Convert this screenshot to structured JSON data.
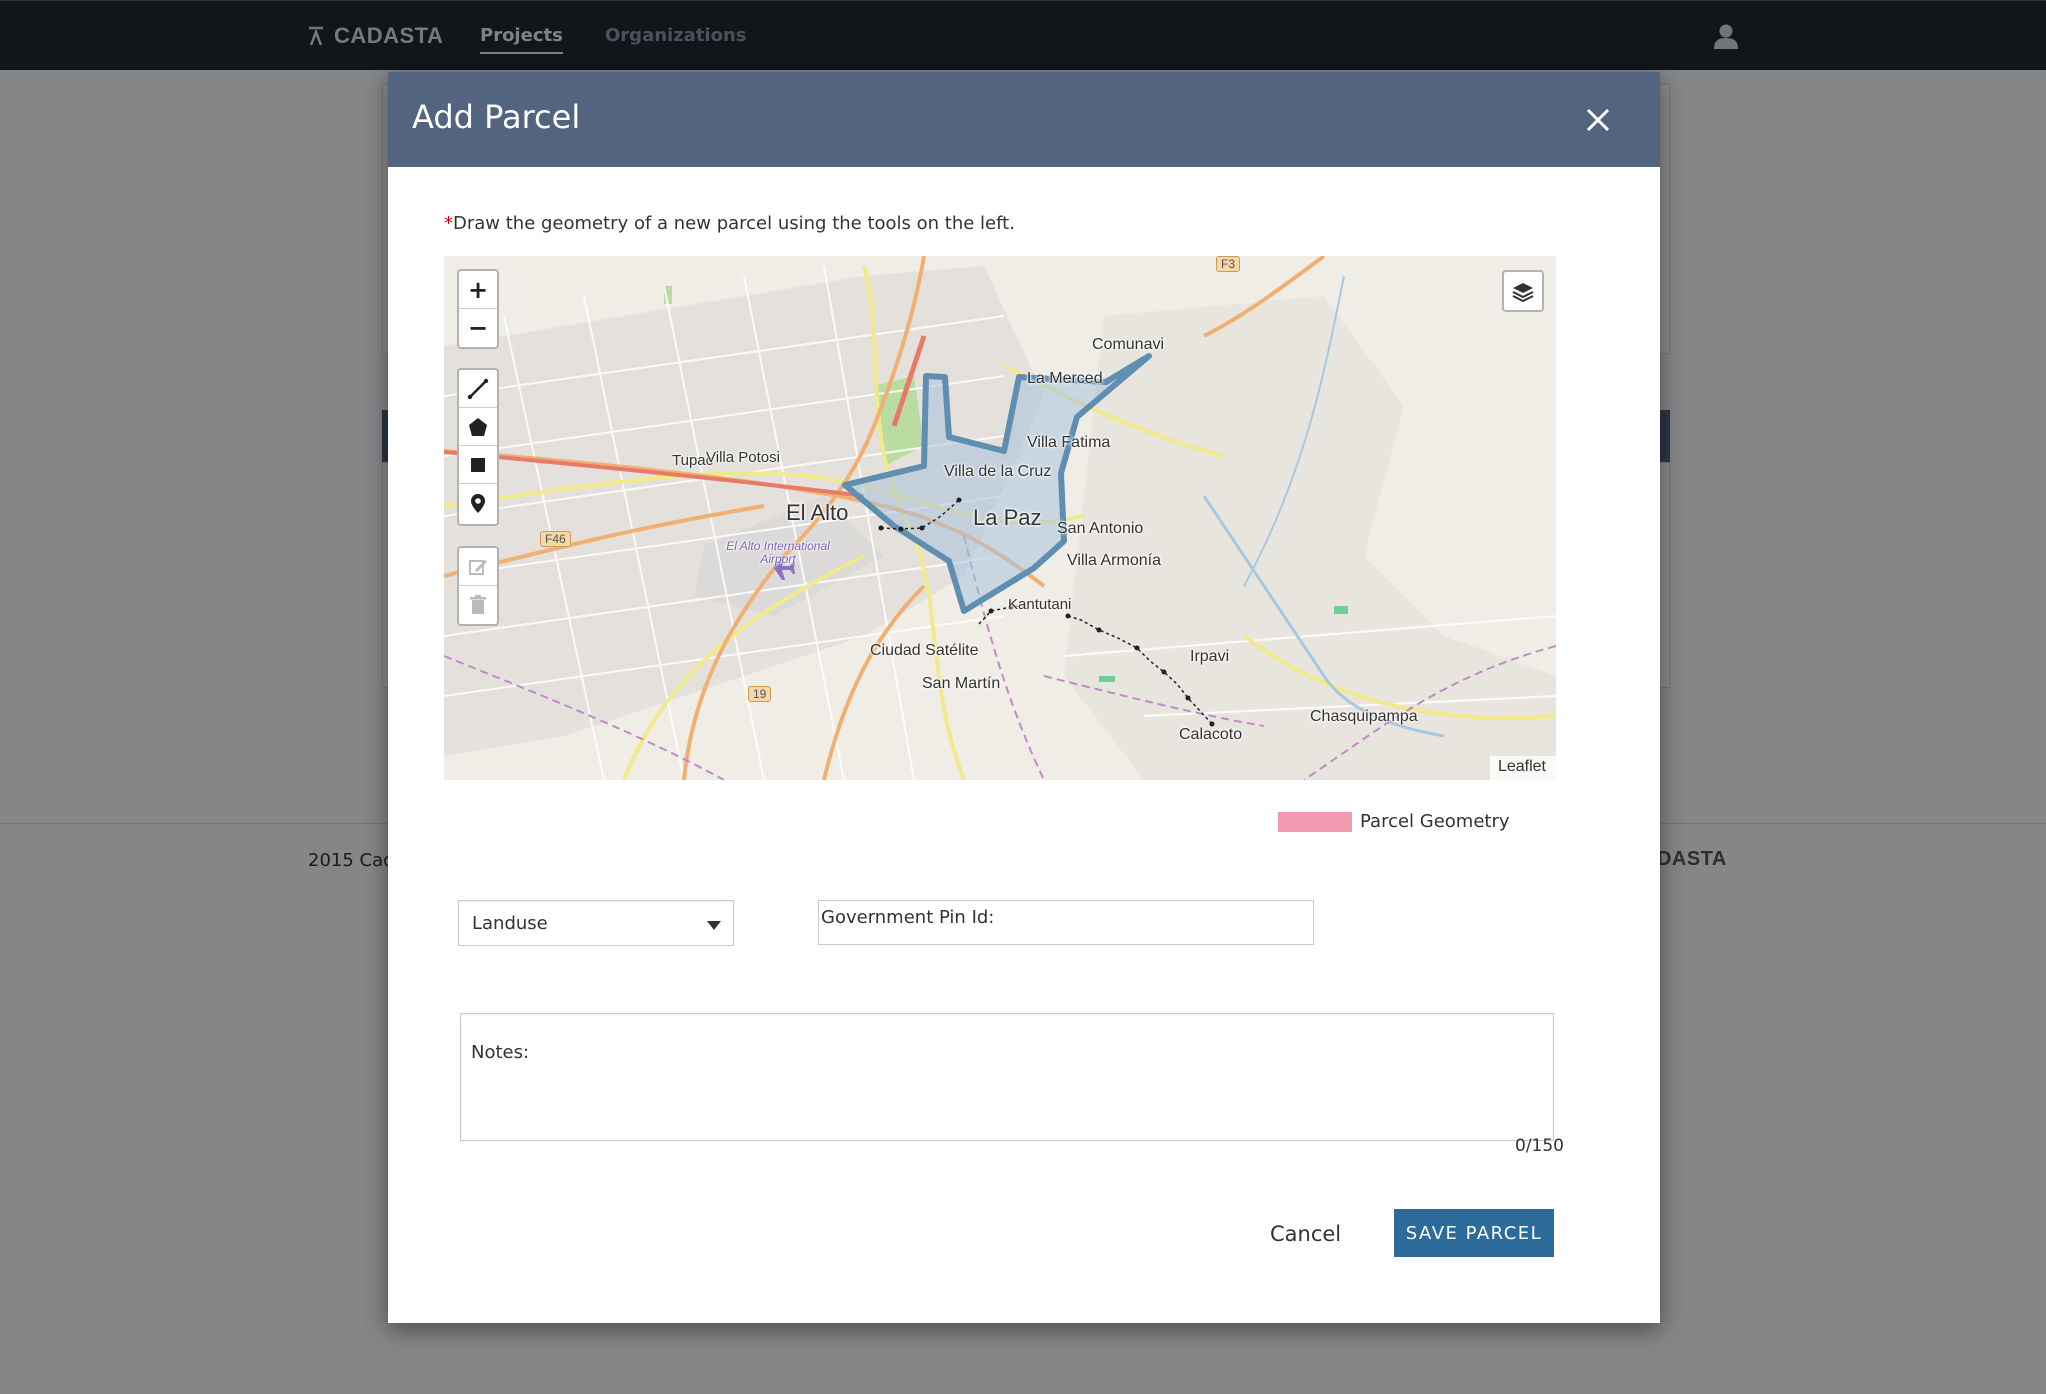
{
  "nav": {
    "brand": "CADASTA",
    "links": [
      {
        "label": "Projects",
        "active": true
      },
      {
        "label": "Organizations",
        "active": false
      }
    ]
  },
  "background": {
    "footer_left": "2015 Cad",
    "footer_right": "ADASTA"
  },
  "modal": {
    "title": "Add Parcel",
    "required_marker": "*",
    "instruction": "Draw the geometry of a new parcel using the tools on the left.",
    "map": {
      "zoom_in": "+",
      "zoom_out": "−",
      "attribution": "Leaflet",
      "draw_tools": [
        "polyline",
        "polygon",
        "rectangle",
        "marker"
      ],
      "edit_tools": [
        "edit",
        "delete"
      ],
      "place_labels": {
        "comunavi": "Comunavi",
        "la_merced": "La Merced",
        "villa_fatima": "Villa Fatima",
        "tupac": "Tupac",
        "villa_potosi": "Villa Potosi",
        "villa_de_la_cruz": "Villa de la Cruz",
        "el_alto": "El Alto",
        "la_paz": "La Paz",
        "san_antonio": "San Antonio",
        "villa_armonia": "Villa Armonía",
        "airport": "El Alto International Airport",
        "kantutani": "Kantutani",
        "ciudad_satellite": "Ciudad Satélite",
        "san_martin": "San Martín",
        "irpavi": "Irpavi",
        "chasquipampa": "Chasquipampa",
        "calacoto": "Calacoto"
      },
      "road_badges": {
        "f3": "F3",
        "f46": "F46",
        "r19": "19"
      }
    },
    "legend": {
      "label": "Parcel Geometry",
      "color": "#f19bb2"
    },
    "landuse": {
      "selected": "Landuse"
    },
    "gov_pin": {
      "placeholder": "Government Pin Id:"
    },
    "notes": {
      "placeholder": "Notes:",
      "counter": "0/150"
    },
    "cancel_label": "Cancel",
    "save_label": "SAVE PARCEL"
  },
  "colors": {
    "navbar": "#222831",
    "modal_header": "#52647f",
    "primary_button": "#2c6b9a",
    "parcel_outline": "#5f8eb0"
  }
}
